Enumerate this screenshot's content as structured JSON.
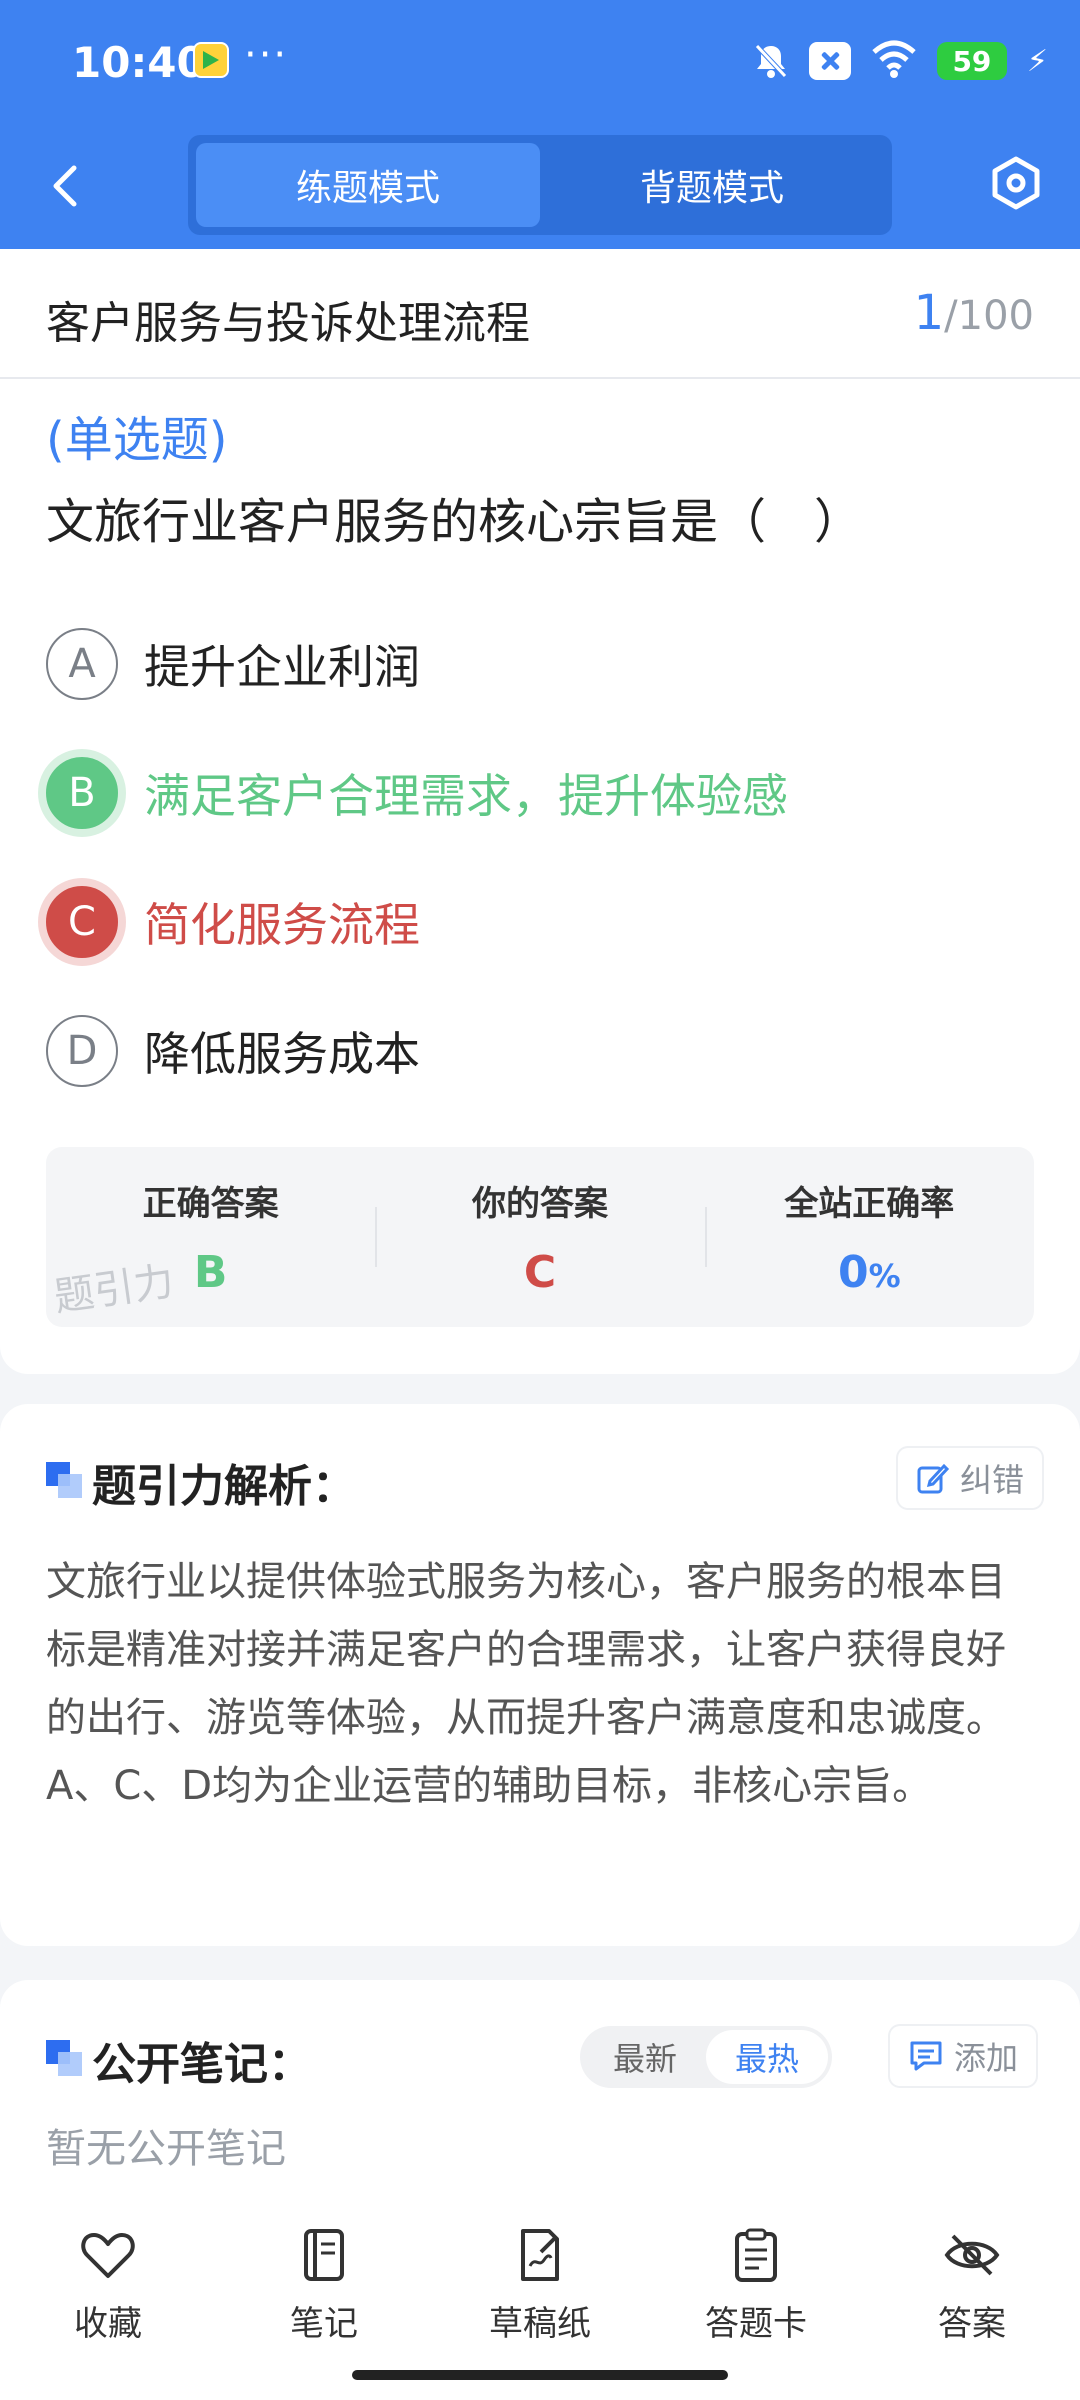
{
  "status": {
    "time": "10:40",
    "dots": "···",
    "battery": "59",
    "colors": {
      "bar": "#3e82f1"
    }
  },
  "header": {
    "tabs": [
      {
        "label": "练题模式",
        "active": true
      },
      {
        "label": "背题模式",
        "active": false
      }
    ],
    "icons": {
      "back": "chevron-left-icon",
      "settings": "hexagon-settings-icon"
    }
  },
  "question": {
    "section_title": "客户服务与投诉处理流程",
    "current": "1",
    "total": "/100",
    "type": "(单选题)",
    "text": "文旅行业客户服务的核心宗旨是（　）",
    "options": [
      {
        "letter": "A",
        "text": "提升企业利润",
        "state": "normal"
      },
      {
        "letter": "B",
        "text": "满足客户合理需求，提升体验感",
        "state": "correct"
      },
      {
        "letter": "C",
        "text": "简化服务流程",
        "state": "wrong"
      },
      {
        "letter": "D",
        "text": "降低服务成本",
        "state": "normal"
      }
    ]
  },
  "stats": {
    "correct_label": "正确答案",
    "correct_value": "B",
    "yours_label": "你的答案",
    "yours_value": "C",
    "rate_label": "全站正确率",
    "rate_value": "0",
    "rate_unit": "%",
    "watermark": "题引力"
  },
  "analysis": {
    "title": "题引力解析：",
    "report_label": "纠错",
    "body": "文旅行业以提供体验式服务为核心，客户服务的根本目标是精准对接并满足客户的合理需求，让客户获得良好的出行、游览等体验，从而提升客户满意度和忠诚度。A、C、D均为企业运营的辅助目标，非核心宗旨。"
  },
  "notes": {
    "title": "公开笔记：",
    "sort_options": [
      {
        "label": "最新",
        "active": false
      },
      {
        "label": "最热",
        "active": true
      }
    ],
    "add_label": "添加",
    "empty_text": "暂无公开笔记"
  },
  "bottom_nav": [
    {
      "label": "收藏",
      "icon": "heart-icon"
    },
    {
      "label": "笔记",
      "icon": "notebook-icon"
    },
    {
      "label": "草稿纸",
      "icon": "draft-paper-icon"
    },
    {
      "label": "答题卡",
      "icon": "answer-card-icon"
    },
    {
      "label": "答案",
      "icon": "eye-off-icon"
    }
  ],
  "colors": {
    "accent": "#3e82f1",
    "correct": "#5fc886",
    "wrong": "#cf4c48"
  }
}
